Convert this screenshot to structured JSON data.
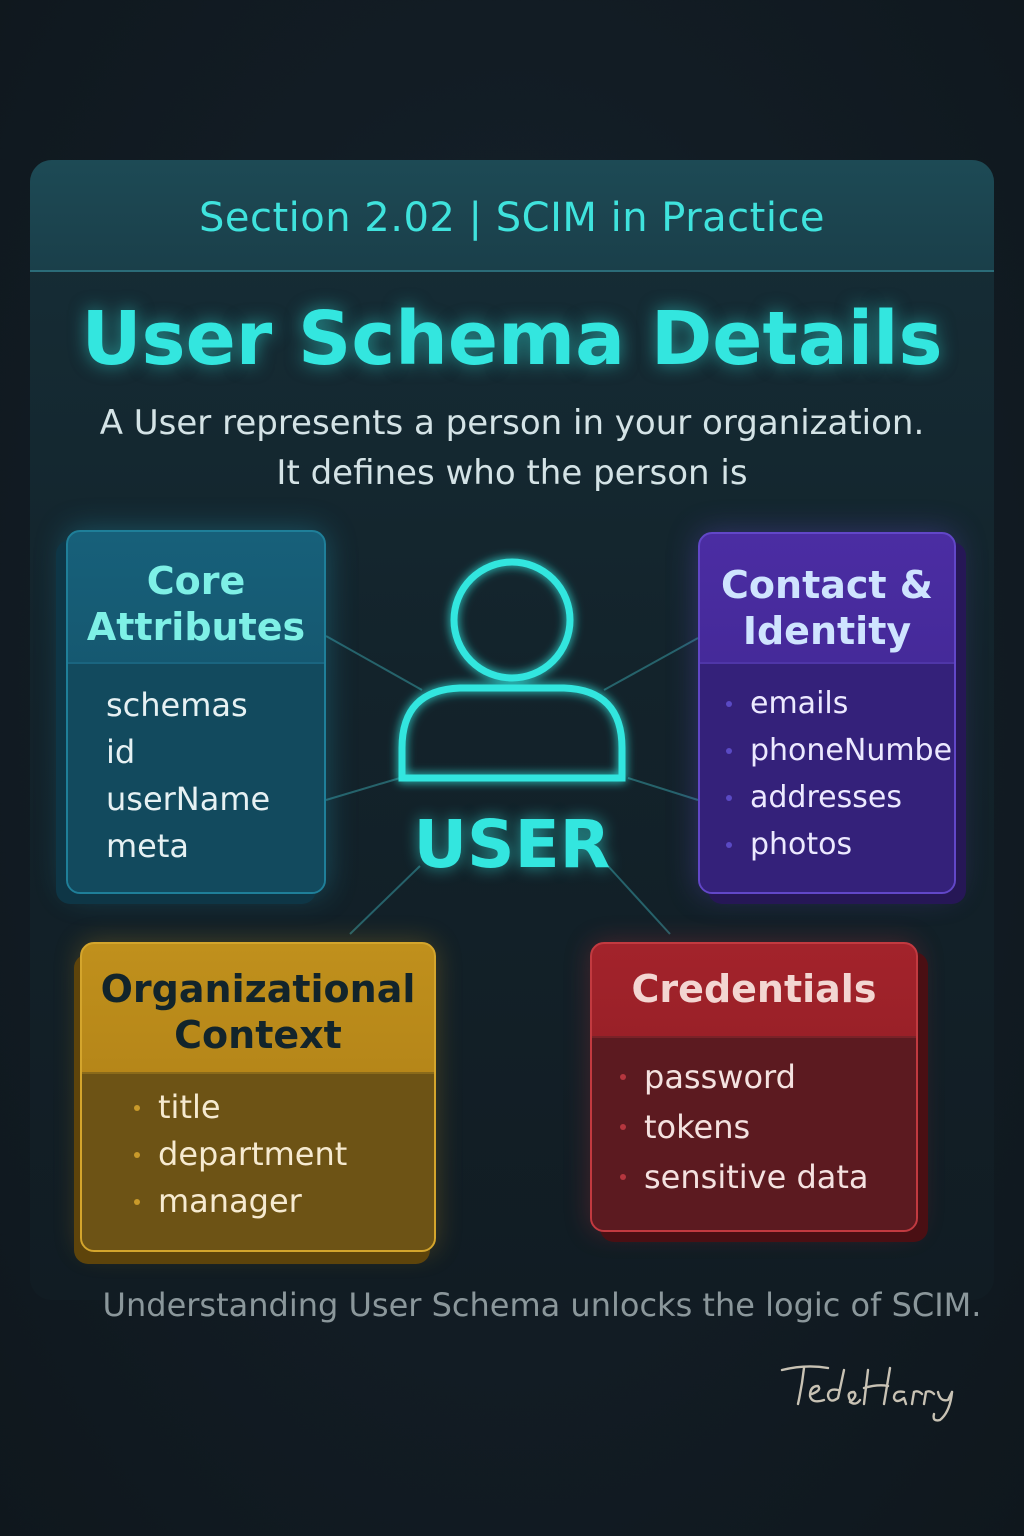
{
  "header": {
    "section_label": "Section 2.02 | SCIM in Practice",
    "title": "User Schema Details",
    "subtitle_line1": "A User represents a person in your organization.",
    "subtitle_line2": "It defines who the person is"
  },
  "center": {
    "icon": "user-icon",
    "label": "USER"
  },
  "cards": {
    "core": {
      "title_line1": "Core",
      "title_line2": "Attributes",
      "items": [
        "schemas",
        "id",
        "userName",
        "meta"
      ],
      "color": "#17607a"
    },
    "contact": {
      "title_line1": "Contact &",
      "title_line2": "Identity",
      "items": [
        "emails",
        "phoneNumbers",
        "addresses",
        "photos"
      ],
      "color": "#4b2da3"
    },
    "org": {
      "title_line1": "Organizational",
      "title_line2": "Context",
      "items": [
        "title",
        "department",
        "manager"
      ],
      "color": "#c0901c"
    },
    "cred": {
      "title": "Credentials",
      "items": [
        "password",
        "tokens",
        "sensitive data"
      ],
      "color": "#a3232b"
    }
  },
  "footer": {
    "text": "Understanding User Schema unlocks the logic of SCIM.",
    "signature": "Ted&Harry"
  },
  "colors": {
    "accent": "#33e6df",
    "background": "#121c24"
  }
}
